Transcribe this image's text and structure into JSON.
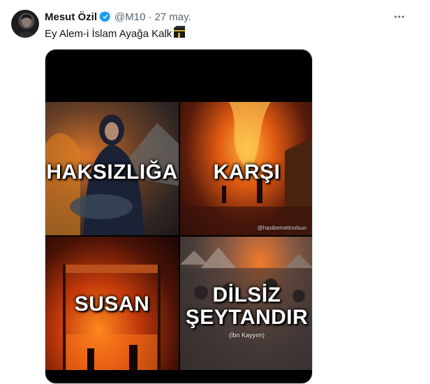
{
  "tweet": {
    "author_name": "Mesut Özil",
    "handle": "@M10",
    "separator": "·",
    "date": "27 may.",
    "text": "Ey Alem-i İslam Ayağa Kalk",
    "emoji_icon": "kaaba-icon"
  },
  "media": {
    "panels": [
      {
        "caption": "HAKSIZLIĞA"
      },
      {
        "caption": "KARŞI",
        "credit": "@hasibemetinolsun"
      },
      {
        "caption": "SUSAN"
      },
      {
        "caption_line1": "DİLSİZ",
        "caption_line2": "ŞEYTANDIR",
        "credit": "(İbn Kayyım)"
      }
    ]
  },
  "colors": {
    "text_primary": "#0f1419",
    "text_secondary": "#536471",
    "verified_blue": "#1d9bf0",
    "border": "#cfd9de"
  }
}
